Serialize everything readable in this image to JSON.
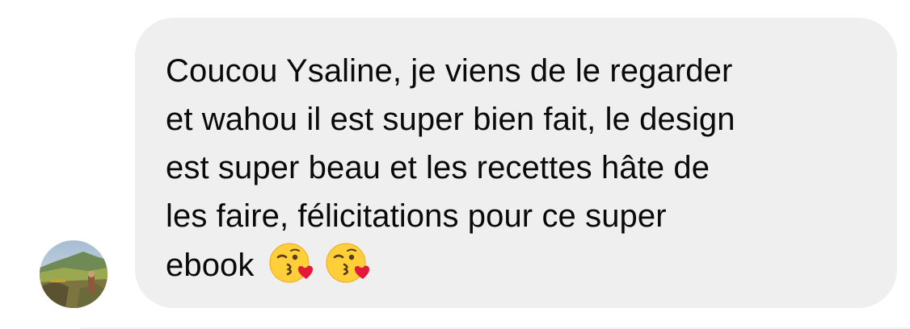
{
  "message": {
    "sender_avatar_icon": "landscape-photo-avatar",
    "lines": [
      "Coucou Ysaline, je viens de le regarder",
      "et wahou il est super bien fait, le design",
      "est super beau et les recettes hâte de",
      "les faire, félicitations pour ce super",
      "ebook"
    ],
    "emojis": [
      "face-blowing-a-kiss-icon",
      "face-blowing-a-kiss-icon"
    ],
    "bubble_color": "#efefef",
    "text_color": "#0a0a0a"
  }
}
